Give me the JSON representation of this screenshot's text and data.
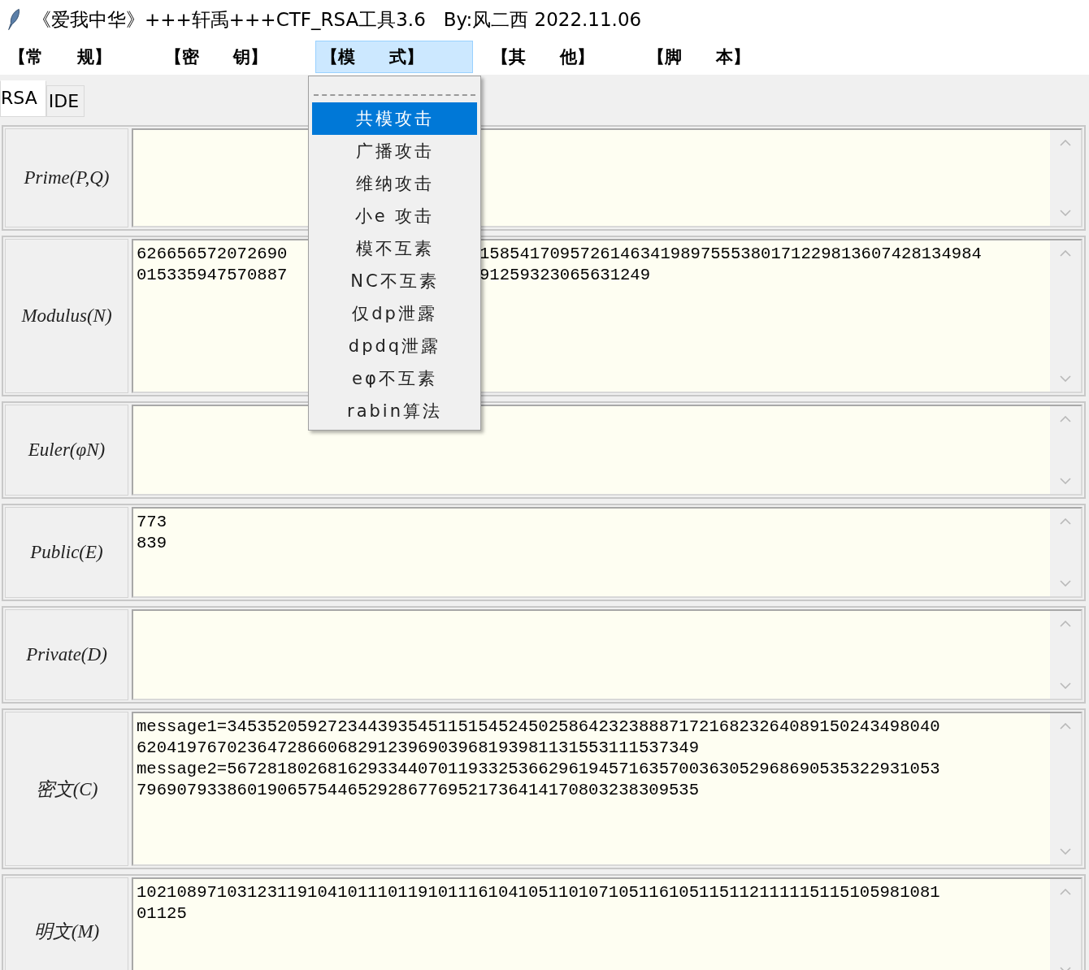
{
  "window": {
    "title": "《爱我中华》+++轩禹+++CTF_RSA工具3.6   By:风二西 2022.11.06"
  },
  "menu": [
    {
      "label": "【常　　规】",
      "selected": false
    },
    {
      "label": "【密　　钥】",
      "selected": false
    },
    {
      "label": "【模　　式】",
      "selected": true
    },
    {
      "label": "【其　　他】",
      "selected": false
    },
    {
      "label": "【脚　　本】",
      "selected": false
    }
  ],
  "dropdown": {
    "items": [
      {
        "label": "共模攻击",
        "selected": true
      },
      {
        "label": "广播攻击",
        "selected": false
      },
      {
        "label": "维纳攻击",
        "selected": false
      },
      {
        "label": "小e 攻击",
        "selected": false
      },
      {
        "label": "模不互素",
        "selected": false
      },
      {
        "label": "NC不互素",
        "selected": false
      },
      {
        "label": "仅dp泄露",
        "selected": false
      },
      {
        "label": "dpdq泄露",
        "selected": false
      },
      {
        "label": "eφ不互素",
        "selected": false
      },
      {
        "label": "rabin算法",
        "selected": false
      }
    ]
  },
  "tabs": [
    {
      "label": "RSA",
      "selected": true
    },
    {
      "label": "IDE",
      "selected": false
    }
  ],
  "fields": [
    {
      "label": "Prime(P,Q)"
    },
    {
      "label": "Modulus(N)",
      "lines": [
        [
          "626656572072690",
          "15854170957261463419897555380171229813607428134984"
        ],
        [
          "015335947570887",
          "91259323065631249"
        ]
      ]
    },
    {
      "label": "Euler(φN)"
    },
    {
      "label": "Public(E)",
      "lines": [
        [
          "773"
        ],
        [
          "839"
        ]
      ]
    },
    {
      "label": "Private(D)"
    },
    {
      "label": "密文(C)",
      "lines": [
        [
          "message1=34535205927234439354511515452450258642323888717216823264089150243498040"
        ],
        [
          "62041976702364728660682912396903968193981131553111537349"
        ],
        [
          "message2=56728180268162933440701193325366296194571635700363052968690535322931053"
        ],
        [
          "79690793386019065754465292867769521736414170803238309535"
        ]
      ]
    },
    {
      "label": "明文(M)",
      "lines": [
        [
          "10210897103123119104101110119101116104105110107105116105115112111115115105981081"
        ],
        [
          "01125"
        ]
      ]
    }
  ]
}
